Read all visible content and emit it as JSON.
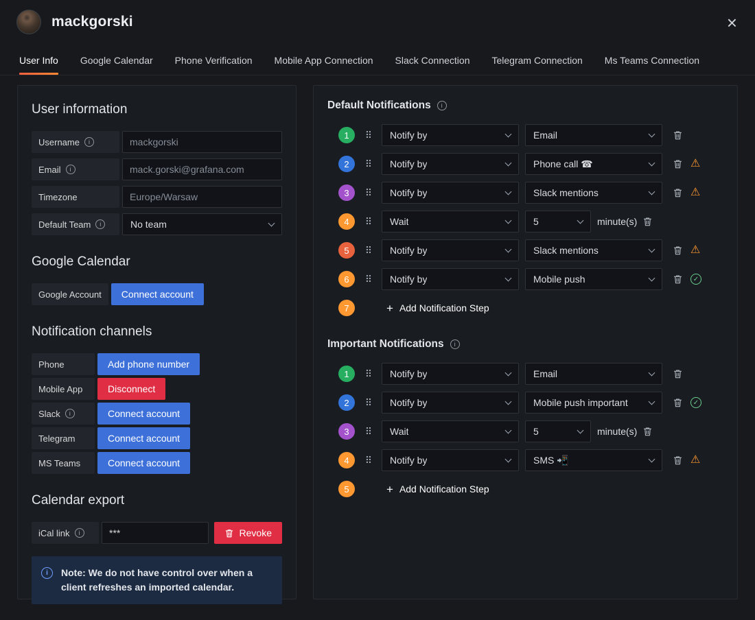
{
  "header": {
    "title": "mackgorski"
  },
  "tabs": [
    {
      "label": "User Info",
      "active": true
    },
    {
      "label": "Google Calendar",
      "active": false
    },
    {
      "label": "Phone Verification",
      "active": false
    },
    {
      "label": "Mobile App Connection",
      "active": false
    },
    {
      "label": "Slack Connection",
      "active": false
    },
    {
      "label": "Telegram Connection",
      "active": false
    },
    {
      "label": "Ms Teams Connection",
      "active": false
    }
  ],
  "colors": {
    "primary_button": "#3d71d9",
    "danger_button": "#e02f44",
    "tab_accent": "#ff8833",
    "warning": "#ff9830",
    "success": "#6ccf8e"
  },
  "user_info": {
    "heading": "User information",
    "fields": [
      {
        "label": "Username",
        "value": "mackgorski"
      },
      {
        "label": "Email",
        "value": "mack.gorski@grafana.com"
      },
      {
        "label": "Timezone",
        "value": "Europe/Warsaw"
      },
      {
        "label": "Default Team",
        "value": "No team"
      }
    ]
  },
  "google_calendar": {
    "heading": "Google Calendar",
    "account_label": "Google Account",
    "connect_button": "Connect account"
  },
  "notification_channels": {
    "heading": "Notification channels",
    "rows": [
      {
        "label": "Phone",
        "button": "Add phone number",
        "variant": "primary"
      },
      {
        "label": "Mobile App",
        "button": "Disconnect",
        "variant": "danger"
      },
      {
        "label": "Slack",
        "button": "Connect account",
        "variant": "primary"
      },
      {
        "label": "Telegram",
        "button": "Connect account",
        "variant": "primary"
      },
      {
        "label": "MS Teams",
        "button": "Connect account",
        "variant": "primary"
      }
    ]
  },
  "calendar_export": {
    "heading": "Calendar export",
    "ical_label": "iCal link",
    "ical_value": "***",
    "revoke_button": "Revoke",
    "note": "Note: We do not have control over when a client refreshes an imported calendar."
  },
  "default_notifications": {
    "heading": "Default Notifications",
    "steps": [
      {
        "num": "1",
        "color": "#27ae60",
        "first": "Notify by",
        "second": "Email"
      },
      {
        "num": "2",
        "color": "#3274d9",
        "first": "Notify by",
        "second": "Phone call ☎",
        "status": "warning"
      },
      {
        "num": "3",
        "color": "#a352cc",
        "first": "Notify by",
        "second": "Slack mentions",
        "status": "warning"
      },
      {
        "num": "4",
        "color": "#ff9830",
        "first": "Wait",
        "second": "5",
        "suffix": "minute(s)"
      },
      {
        "num": "5",
        "color": "#e8623d",
        "first": "Notify by",
        "second": "Slack mentions",
        "status": "warning"
      },
      {
        "num": "6",
        "color": "#ff9830",
        "first": "Notify by",
        "second": "Mobile push",
        "status": "ok"
      },
      {
        "num": "7",
        "color": "#ff9830",
        "add_label": "Add Notification Step"
      }
    ]
  },
  "important_notifications": {
    "heading": "Important Notifications",
    "steps": [
      {
        "num": "1",
        "color": "#27ae60",
        "first": "Notify by",
        "second": "Email"
      },
      {
        "num": "2",
        "color": "#3274d9",
        "first": "Notify by",
        "second": "Mobile push important",
        "status": "ok"
      },
      {
        "num": "3",
        "color": "#a352cc",
        "first": "Wait",
        "second": "5",
        "suffix": "minute(s)"
      },
      {
        "num": "4",
        "color": "#ff9830",
        "first": "Notify by",
        "second": "SMS 📲",
        "status": "warning"
      },
      {
        "num": "5",
        "color": "#ff9830",
        "add_label": "Add Notification Step"
      }
    ]
  }
}
